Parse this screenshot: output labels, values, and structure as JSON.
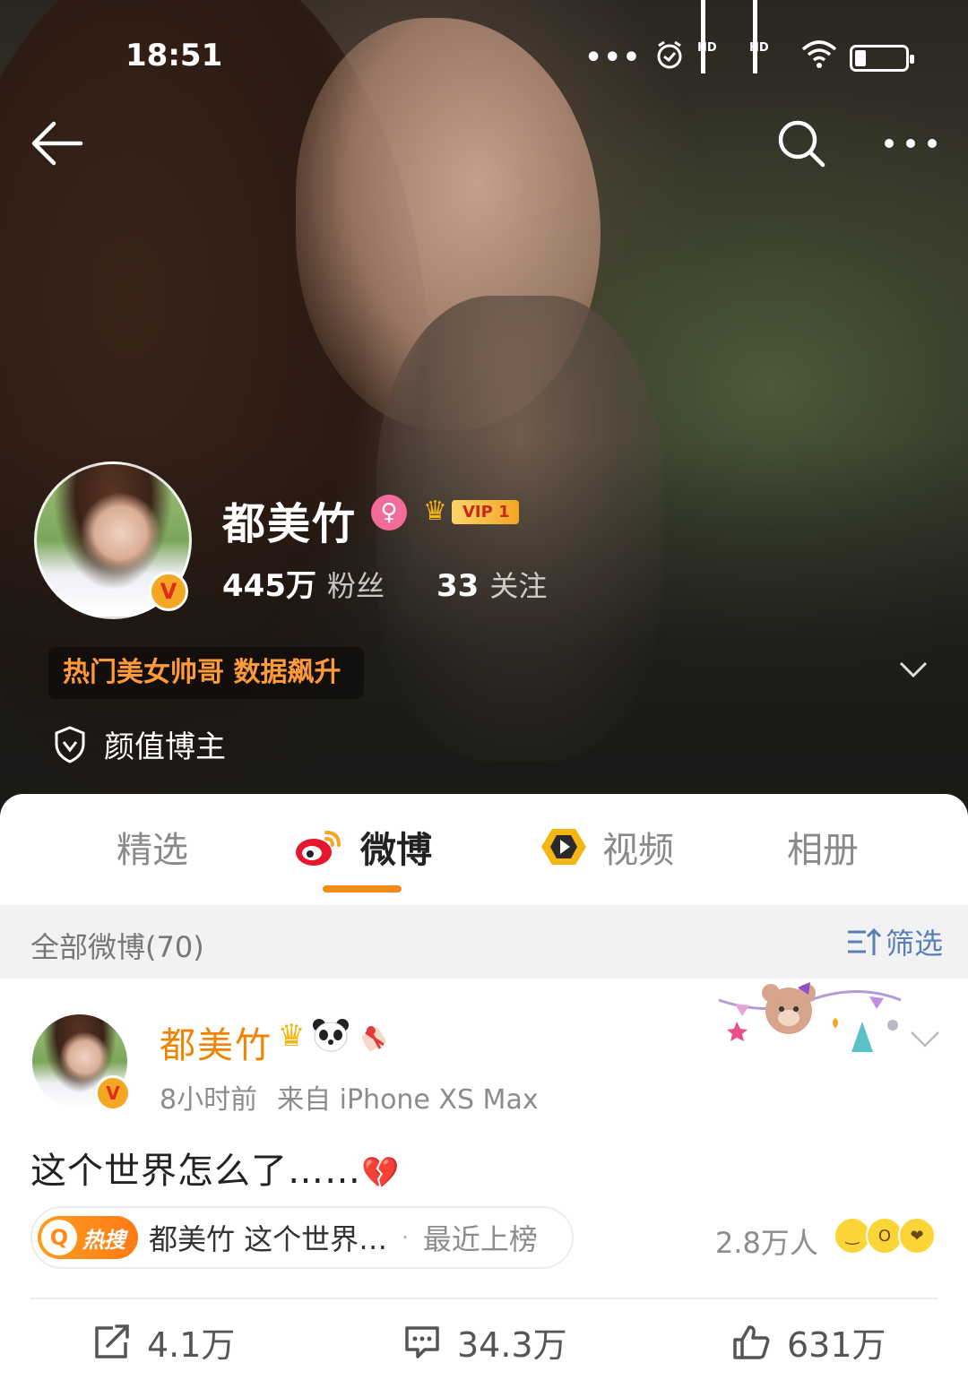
{
  "status_bar": {
    "time": "18:51",
    "icons": [
      "more-dots-icon",
      "alarm-icon",
      "hd-signal-icon",
      "hd-signal-icon",
      "wifi-icon",
      "battery-icon"
    ],
    "hd_label": "HD"
  },
  "nav": {
    "back_icon": "back-arrow-icon",
    "search_icon": "search-icon",
    "more_icon": "more-icon"
  },
  "profile": {
    "name": "都美竹",
    "gender_symbol": "♀",
    "vip_label": "VIP 1",
    "verified_mark": "V",
    "followers_count": "445万",
    "followers_label": "粉丝",
    "following_count": "33",
    "following_label": "关注",
    "hot_tag": "热门美女帅哥 数据飙升",
    "role": "颜值博主"
  },
  "tabs": [
    {
      "label": "精选",
      "active": false
    },
    {
      "label": "微博",
      "active": true
    },
    {
      "label": "视频",
      "active": false
    },
    {
      "label": "相册",
      "active": false
    }
  ],
  "filter": {
    "count_label": "全部微博(70)",
    "filter_label": "筛选"
  },
  "post": {
    "author": "都美竹",
    "author_icons": [
      "crown-icon",
      "panda-icon",
      "gift-icon"
    ],
    "time": "8小时前",
    "source": "来自 iPhone XS Max",
    "text": "这个世界怎么了……",
    "text_emoji": "💔",
    "hot_search": {
      "badge": "热搜",
      "topic": "都美竹 这个世界…",
      "separator": "·",
      "status": "最近上榜",
      "people": "2.8万人"
    },
    "actions": {
      "repost": "4.1万",
      "comment": "34.3万",
      "like": "631万"
    }
  },
  "colors": {
    "accent_orange": "#f28a1e",
    "author_orange": "#f08300",
    "filter_blue": "#5a7fb8",
    "hot_tag_orange": "#ff9a3a"
  }
}
